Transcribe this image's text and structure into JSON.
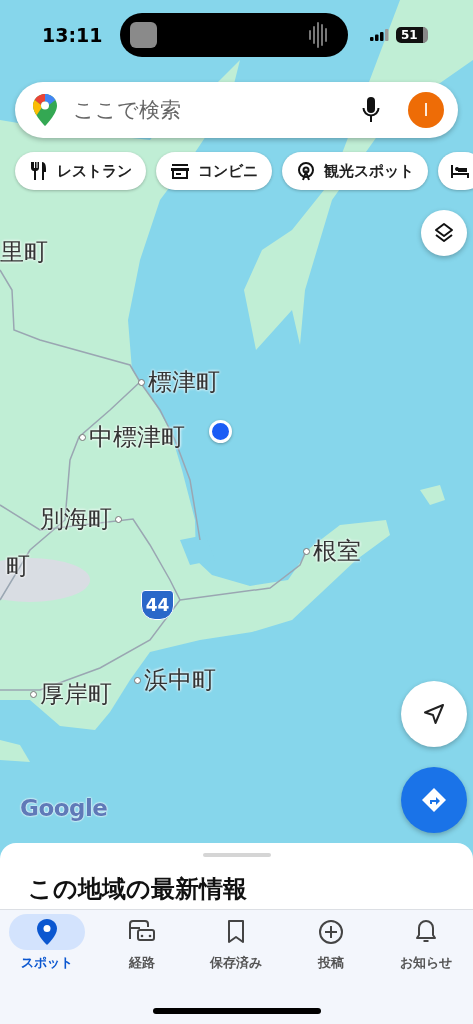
{
  "status_bar": {
    "time": "13:11",
    "battery": "51"
  },
  "search": {
    "placeholder": "ここで検索",
    "avatar_initial": "I"
  },
  "chips": [
    {
      "label": "レストラン",
      "kind": "restaurant"
    },
    {
      "label": "コンビニ",
      "kind": "store"
    },
    {
      "label": "観光スポット",
      "kind": "sights"
    },
    {
      "kind": "hotel"
    }
  ],
  "map": {
    "places": [
      {
        "name": "里町",
        "kind": "edge"
      },
      {
        "name": "標津町",
        "kind": "town"
      },
      {
        "name": "中標津町",
        "kind": "town"
      },
      {
        "name": "別海町",
        "kind": "town"
      },
      {
        "name": "町",
        "kind": "edge"
      },
      {
        "name": "根室",
        "kind": "town"
      },
      {
        "name": "浜中町",
        "kind": "town"
      },
      {
        "name": "厚岸町",
        "kind": "town"
      }
    ],
    "road_shield": "44",
    "attribution": "Google"
  },
  "sheet": {
    "title": "この地域の最新情報"
  },
  "nav": [
    {
      "label": "スポット",
      "kind": "spot",
      "selected": true
    },
    {
      "label": "経路",
      "kind": "route",
      "selected": false
    },
    {
      "label": "保存済み",
      "kind": "saved",
      "selected": false
    },
    {
      "label": "投稿",
      "kind": "post",
      "selected": false
    },
    {
      "label": "お知らせ",
      "kind": "updates",
      "selected": false
    }
  ]
}
